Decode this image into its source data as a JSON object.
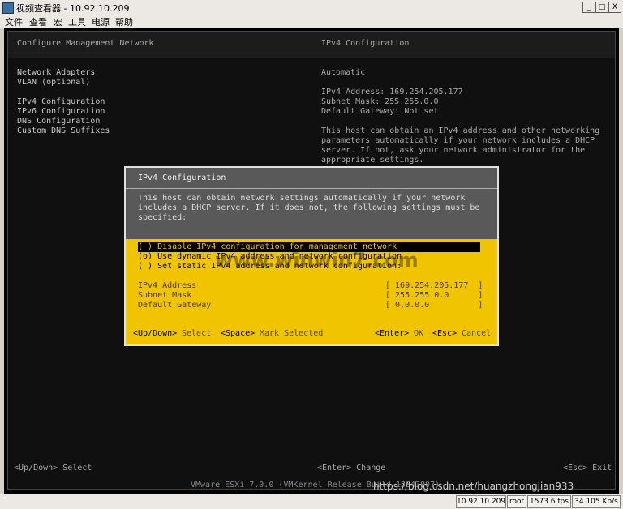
{
  "window": {
    "title": "视频查看器 - 10.92.10.209",
    "min_btn": "_",
    "max_btn": "□",
    "close_btn": "X"
  },
  "menu": [
    "文件",
    "查看",
    "宏",
    "工具",
    "电源",
    "帮助"
  ],
  "console": {
    "left_header": "Configure Management Network",
    "right_header": "IPv4 Configuration",
    "left_menu": [
      "Network Adapters",
      "VLAN (optional)",
      "IPv4 Configuration",
      "IPv6 Configuration",
      "DNS Configuration",
      "Custom DNS Suffixes"
    ],
    "right_mode": "Automatic",
    "right_info": [
      "IPv4 Address: 169.254.205.177",
      "Subnet Mask: 255.255.0.0",
      "Default Gateway: Not set"
    ],
    "right_desc": [
      "This host can obtain an IPv4 address and other networking",
      "parameters automatically if your network includes a DHCP",
      "server. If not, ask your network administrator for the",
      "appropriate settings."
    ],
    "footer_left": "<Up/Down> Select",
    "footer_mid": "<Enter> Change",
    "footer_right": "<Esc> Exit",
    "version": "VMware ESXi 7.0.0 (VMKernel Release Build 15843807)"
  },
  "dialog": {
    "title": "IPv4 Configuration",
    "description": [
      "This host can obtain network settings automatically if your network",
      "includes a DHCP server. If it does not, the following settings must be",
      "specified:"
    ],
    "options": [
      {
        "label": "( ) Disable IPv4 configuration for management network",
        "selected": true
      },
      {
        "label": "(o) Use dynamic IPv4 address and network configuration",
        "selected": false
      },
      {
        "label": "( ) Set static IPv4 address and network configuration:",
        "selected": false
      }
    ],
    "fields": [
      {
        "label": "IPv4 Address",
        "value": "[ 169.254.205.177  ]"
      },
      {
        "label": "Subnet Mask",
        "value": "[ 255.255.0.0      ]"
      },
      {
        "label": "Default Gateway",
        "value": "[ 0.0.0.0          ]"
      }
    ],
    "keys": {
      "updown_key": "<Up/Down>",
      "updown_label": "Select",
      "space_key": "<Space>",
      "space_label": "Mark Selected",
      "enter_key": "<Enter>",
      "enter_label": "OK",
      "esc_key": "<Esc>",
      "esc_label": "Cancel"
    }
  },
  "watermark_center": "www.winwin7.com",
  "watermark_bottom": "https://blog.csdn.net/huangzhongjian933",
  "status": [
    "10.92.10.209",
    "root",
    "1573.6 fps",
    "34.105 Kb/s"
  ]
}
